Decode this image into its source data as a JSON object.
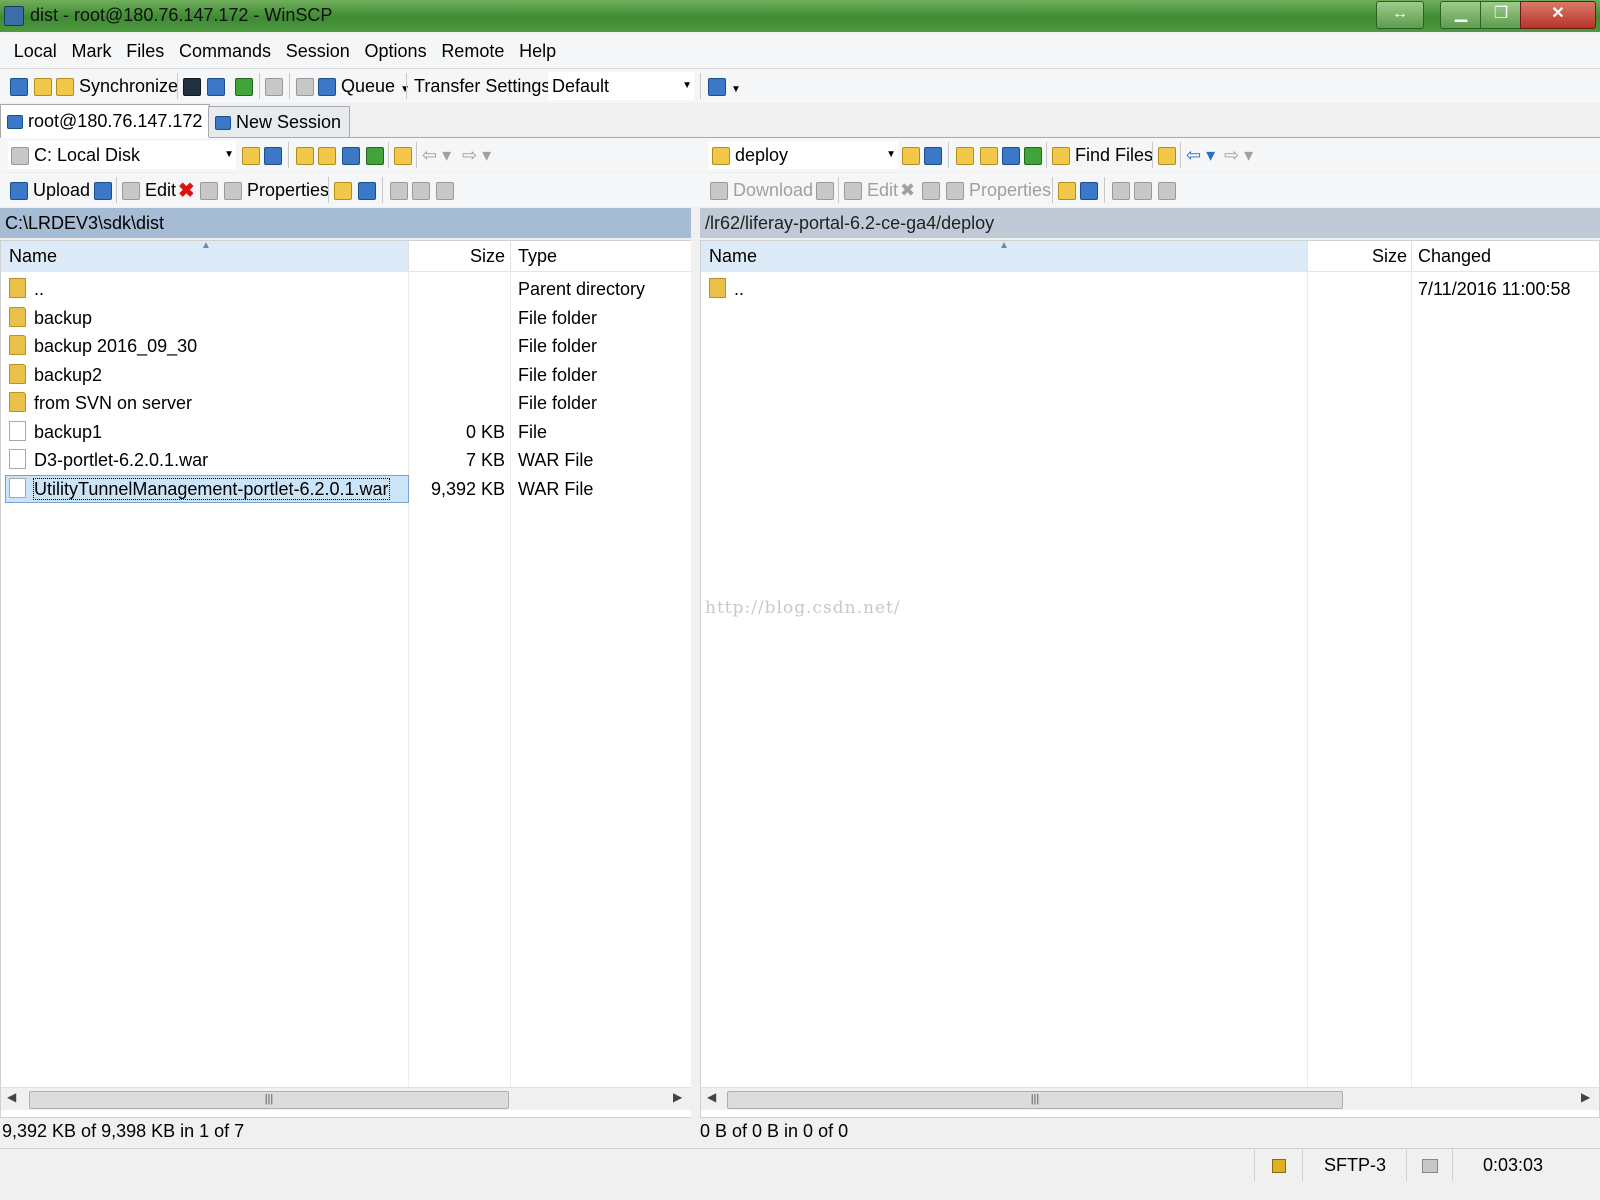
{
  "window": {
    "title": "dist - root@180.76.147.172 - WinSCP",
    "buttons": {
      "restore_h": "↔",
      "minimize": "▁",
      "maximize": "❐",
      "close": "✕"
    }
  },
  "menu": [
    "Local",
    "Mark",
    "Files",
    "Commands",
    "Session",
    "Options",
    "Remote",
    "Help"
  ],
  "toolbar": {
    "synchronize": "Synchronize",
    "queue": "Queue",
    "transfer_settings_label": "Transfer Settings",
    "transfer_settings_value": "Default"
  },
  "tabs": {
    "session": "root@180.76.147.172",
    "new_session": "New Session"
  },
  "local": {
    "drive": "C: Local Disk",
    "actions": {
      "upload": "Upload",
      "edit": "Edit",
      "properties": "Properties"
    },
    "path": "C:\\LRDEV3\\sdk\\dist",
    "columns": {
      "name": "Name",
      "size": "Size",
      "type": "Type"
    },
    "files": [
      {
        "name": "..",
        "size": "",
        "type": "Parent directory",
        "kind": "up"
      },
      {
        "name": "backup",
        "size": "",
        "type": "File folder",
        "kind": "folder"
      },
      {
        "name": "backup 2016_09_30",
        "size": "",
        "type": "File folder",
        "kind": "folder"
      },
      {
        "name": "backup2",
        "size": "",
        "type": "File folder",
        "kind": "folder"
      },
      {
        "name": "from SVN on server",
        "size": "",
        "type": "File folder",
        "kind": "folder"
      },
      {
        "name": "backup1",
        "size": "0 KB",
        "type": "File",
        "kind": "file"
      },
      {
        "name": "D3-portlet-6.2.0.1.war",
        "size": "7 KB",
        "type": "WAR File",
        "kind": "file"
      },
      {
        "name": "UtilityTunnelManagement-portlet-6.2.0.1.war",
        "size": "9,392 KB",
        "type": "WAR File",
        "kind": "file",
        "selected": true
      }
    ],
    "status": "9,392 KB of 9,398 KB in 1 of 7"
  },
  "remote": {
    "folder": "deploy",
    "find_files": "Find Files",
    "actions": {
      "download": "Download",
      "edit": "Edit",
      "properties": "Properties"
    },
    "path": "/lr62/liferay-portal-6.2-ce-ga4/deploy",
    "columns": {
      "name": "Name",
      "size": "Size",
      "changed": "Changed"
    },
    "files": [
      {
        "name": "..",
        "size": "",
        "changed": "7/11/2016 11:00:58",
        "kind": "up"
      }
    ],
    "status": "0 B of 0 B in 0 of 0"
  },
  "statusbar": {
    "protocol": "SFTP-3",
    "time": "0:03:03"
  },
  "watermark": "http://blog.csdn.net/"
}
